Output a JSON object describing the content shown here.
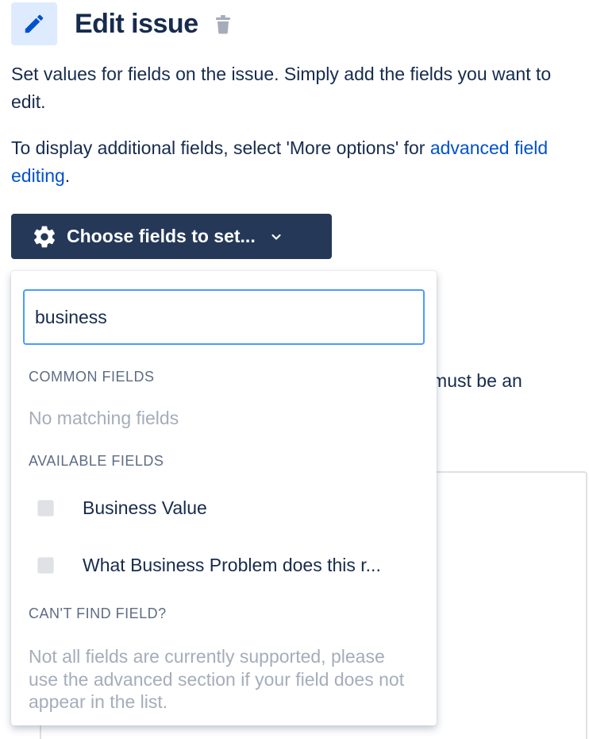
{
  "header": {
    "title": "Edit issue",
    "edit_icon": "pencil-icon",
    "delete_icon": "trash-icon"
  },
  "description": {
    "line1": "Set values for fields on the issue. Simply add the fields you want to edit.",
    "line2_prefix": "To display additional fields, select 'More options' for ",
    "line2_link": "advanced field editing",
    "line2_suffix": "."
  },
  "choose_button": {
    "label": "Choose fields to set...",
    "icon": "gear-icon",
    "chevron": "chevron-down-icon"
  },
  "background": {
    "partial_text": "r must be an"
  },
  "dropdown": {
    "search_value": "business",
    "common_fields_header": "COMMON FIELDS",
    "no_matching": "No matching fields",
    "available_fields_header": "AVAILABLE FIELDS",
    "options": [
      {
        "label": "Business Value",
        "checked": false
      },
      {
        "label": "What Business Problem does this r...",
        "checked": false
      }
    ],
    "cant_find_header": "CAN'T FIND FIELD?",
    "help_text": "Not all fields are currently supported, please use the advanced section if your field does not appear in the list."
  },
  "colors": {
    "primary_text": "#172b4d",
    "link": "#0052cc",
    "button_bg": "#253858",
    "icon_box_bg": "#deebff",
    "focus_border": "#4c9aff",
    "muted_text": "#a5adba",
    "section_header": "#5e6c84"
  }
}
